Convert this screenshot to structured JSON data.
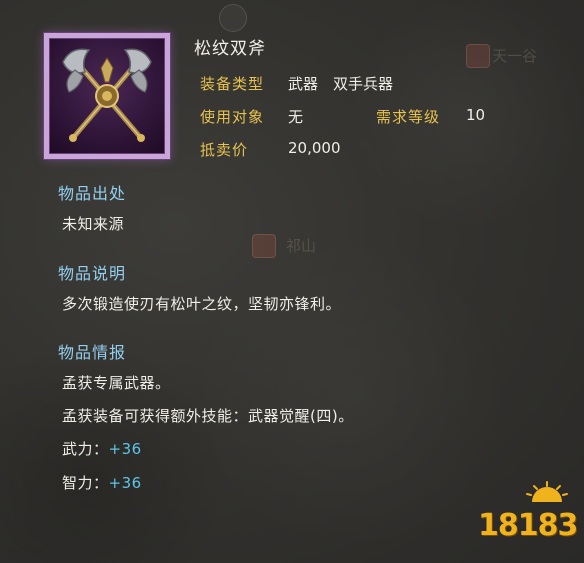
{
  "item": {
    "name": "松纹双斧",
    "attributes": {
      "equip_type_label": "装备类型",
      "equip_type_value": "武器　双手兵器",
      "user_label": "使用对象",
      "user_value": "无",
      "level_req_label": "需求等级",
      "level_req_value": "10",
      "sell_price_label": "抵卖价",
      "sell_price_value": "20,000"
    },
    "icon": "crossed-double-axes-icon"
  },
  "sections": {
    "source_title": "物品出处",
    "source_text": "未知来源",
    "description_title": "物品说明",
    "description_text": "多次锻造使刃有松叶之纹，坚韧亦锋利。",
    "info_title": "物品情报",
    "info_line1": "孟获专属武器。",
    "info_line2": "孟获装备可获得额外技能：武器觉醒(四)。",
    "stat1_label": "武力：",
    "stat1_value": "+36",
    "stat2_label": "智力：",
    "stat2_value": "+36"
  },
  "background_map_labels": {
    "label1": "天一谷",
    "label2": "祁山"
  },
  "watermark": {
    "text": "18183"
  },
  "colors": {
    "label_gold": "#e6c24e",
    "section_blue": "#93d0ef",
    "stat_cyan": "#5bc6e6",
    "frame_purple": "#c9a6d8",
    "logo_orange": "#f1b31d"
  }
}
